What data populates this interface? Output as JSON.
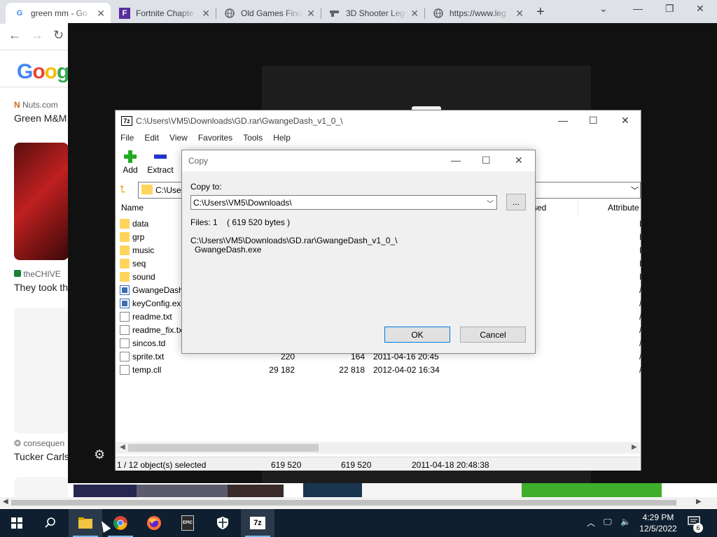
{
  "chrome": {
    "tabs": [
      {
        "label": "green mm - Go",
        "favicon": "G",
        "favicon_color": "#4285f4",
        "active": true
      },
      {
        "label": "Fortnite Chapte",
        "favicon": "F",
        "favicon_color": "#5b2ca0",
        "active": false
      },
      {
        "label": "Old Games Find",
        "favicon": "globe-icon",
        "favicon_color": "#5f6368",
        "active": false
      },
      {
        "label": "3D Shooter Leg",
        "favicon": "gun-icon",
        "favicon_color": "#5f6368",
        "active": false
      },
      {
        "label": "https://www.leg",
        "favicon": "globe-icon",
        "favicon_color": "#5f6368",
        "active": false
      }
    ],
    "new_tab": "+"
  },
  "page": {
    "logo": "Goog",
    "news": [
      {
        "source": "Nuts.com",
        "title": "Green M&M"
      },
      {
        "source": "theCHIVE",
        "title": "They took th"
      },
      {
        "source": "consequen",
        "title": "Tucker Carls"
      }
    ]
  },
  "sevenzip": {
    "logo": "7z",
    "title": "C:\\Users\\VM5\\Downloads\\GD.rar\\GwangeDash_v1_0_\\",
    "menu": [
      "File",
      "Edit",
      "View",
      "Favorites",
      "Tools",
      "Help"
    ],
    "toolbar": {
      "add": "Add",
      "extract": "Extract"
    },
    "address": "C:\\Users",
    "columns": {
      "name": "Name",
      "used": "sed",
      "attributes": "Attribute"
    },
    "files": [
      {
        "name": "data",
        "type": "folder",
        "size": "",
        "packed": "",
        "modified": "",
        "attr": "I"
      },
      {
        "name": "grp",
        "type": "folder",
        "size": "",
        "packed": "",
        "modified": "",
        "attr": "I"
      },
      {
        "name": "music",
        "type": "folder",
        "size": "",
        "packed": "",
        "modified": "",
        "attr": "I"
      },
      {
        "name": "seq",
        "type": "folder",
        "size": "",
        "packed": "",
        "modified": "",
        "attr": "I"
      },
      {
        "name": "sound",
        "type": "folder",
        "size": "",
        "packed": "",
        "modified": "",
        "attr": "I"
      },
      {
        "name": "GwangeDash.",
        "type": "exe",
        "size": "",
        "packed": "",
        "modified": "",
        "attr": "/"
      },
      {
        "name": "keyConfig.exe",
        "type": "exe",
        "size": "",
        "packed": "",
        "modified": "",
        "attr": "/"
      },
      {
        "name": "readme.txt",
        "type": "doc",
        "size": "",
        "packed": "",
        "modified": "",
        "attr": "/"
      },
      {
        "name": "readme_fix.txt",
        "type": "doc",
        "size": "",
        "packed": "",
        "modified": "",
        "attr": "/"
      },
      {
        "name": "sincos.td",
        "type": "doc",
        "size": "",
        "packed": "",
        "modified": "",
        "attr": "/"
      },
      {
        "name": "sprite.txt",
        "type": "doc",
        "size": "220",
        "packed": "164",
        "modified": "2011-04-16 20:45",
        "attr": "/"
      },
      {
        "name": "temp.cll",
        "type": "doc",
        "size": "29 182",
        "packed": "22 818",
        "modified": "2012-04-02 16:34",
        "attr": "/"
      }
    ],
    "status": {
      "selected": "1 / 12 object(s) selected",
      "size": "619 520",
      "packed": "619 520",
      "modified": "2011-04-18 20:48:38"
    }
  },
  "copy_dialog": {
    "title": "Copy",
    "copy_to_label": "Copy to:",
    "path_value": "C:\\Users\\VM5\\Downloads\\",
    "browse_label": "...",
    "files_info": "Files: 1    ( 619 520 bytes )",
    "source_path": "C:\\Users\\VM5\\Downloads\\GD.rar\\GwangeDash_v1_0_\\",
    "source_file": "GwangeDash.exe",
    "ok_label": "OK",
    "cancel_label": "Cancel"
  },
  "taskbar": {
    "clock_time": "4:29 PM",
    "clock_date": "12/5/2022",
    "notification_count": "6",
    "epic_label": "EPIC"
  }
}
